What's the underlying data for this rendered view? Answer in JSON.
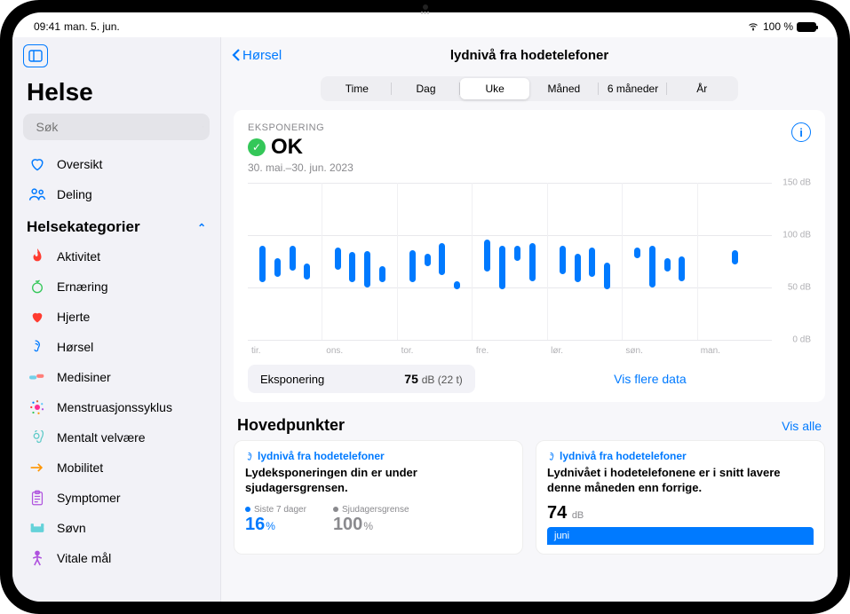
{
  "status": {
    "time": "09:41",
    "date": "man. 5. jun.",
    "battery": "100 %"
  },
  "sidebar": {
    "app_title": "Helse",
    "search_placeholder": "Søk",
    "overview": "Oversikt",
    "sharing": "Deling",
    "categories_header": "Helsekategorier",
    "cats": [
      {
        "label": "Aktivitet"
      },
      {
        "label": "Ernæring"
      },
      {
        "label": "Hjerte"
      },
      {
        "label": "Hørsel"
      },
      {
        "label": "Medisiner"
      },
      {
        "label": "Menstruasjonssyklus"
      },
      {
        "label": "Mentalt velvære"
      },
      {
        "label": "Mobilitet"
      },
      {
        "label": "Symptomer"
      },
      {
        "label": "Søvn"
      },
      {
        "label": "Vitale mål"
      }
    ]
  },
  "main": {
    "back_label": "Hørsel",
    "title": "lydnivå fra hodetelefoner",
    "seg": [
      "Time",
      "Dag",
      "Uke",
      "Måned",
      "6 måneder",
      "År"
    ],
    "seg_selected": 2,
    "exposure_label": "EKSPONERING",
    "ok": "OK",
    "date_range": "30. mai.–30. jun. 2023",
    "ylabels": [
      "150 dB",
      "100 dB",
      "50 dB",
      "0 dB"
    ],
    "days": [
      "tir.",
      "ons.",
      "tor.",
      "fre.",
      "lør.",
      "søn.",
      "man."
    ],
    "summary_label": "Eksponering",
    "summary_value": "75",
    "summary_unit": "dB",
    "summary_extra": "(22 t)",
    "more_data": "Vis flere data"
  },
  "chart_data": {
    "type": "range-bar",
    "title": "lydnivå fra hodetelefoner",
    "ylabel": "dB",
    "ylim": [
      0,
      150
    ],
    "xlabel": "",
    "categories": [
      "tir.",
      "ons.",
      "tor.",
      "fre.",
      "lør.",
      "søn.",
      "man."
    ],
    "series": [
      {
        "name": "Eksponering",
        "ranges_per_category": [
          [
            [
              55,
              90
            ],
            [
              60,
              78
            ],
            [
              66,
              90
            ],
            [
              58,
              73
            ]
          ],
          [
            [
              67,
              88
            ],
            [
              55,
              84
            ],
            [
              50,
              85
            ],
            [
              55,
              70
            ]
          ],
          [
            [
              55,
              86
            ],
            [
              70,
              82
            ],
            [
              62,
              92
            ],
            [
              48,
              56
            ]
          ],
          [
            [
              65,
              96
            ],
            [
              48,
              90
            ],
            [
              75,
              90
            ],
            [
              56,
              92
            ]
          ],
          [
            [
              63,
              90
            ],
            [
              55,
              82
            ],
            [
              60,
              88
            ],
            [
              48,
              74
            ]
          ],
          [
            [
              78,
              88
            ],
            [
              50,
              90
            ],
            [
              65,
              78
            ],
            [
              56,
              80
            ]
          ],
          [
            [
              72,
              86
            ]
          ]
        ]
      }
    ],
    "summary": {
      "value": 75,
      "unit": "dB",
      "duration_hours": 22
    }
  },
  "highlights": {
    "title": "Hovedpunkter",
    "show_all": "Vis alle",
    "card1": {
      "title": "lydnivå fra hodetelefoner",
      "desc": "Lydeksponeringen din er under sjudagersgrensen.",
      "stat1_label": "Siste 7 dager",
      "stat1_value": "16",
      "stat1_unit": "%",
      "stat2_label": "Sjudagersgrense",
      "stat2_value": "100",
      "stat2_unit": "%"
    },
    "card2": {
      "title": "lydnivå fra hodetelefoner",
      "desc": "Lydnivået i hodetelefonene er i snitt lavere denne måneden enn forrige.",
      "value": "74",
      "unit": "dB",
      "month": "juni"
    }
  }
}
